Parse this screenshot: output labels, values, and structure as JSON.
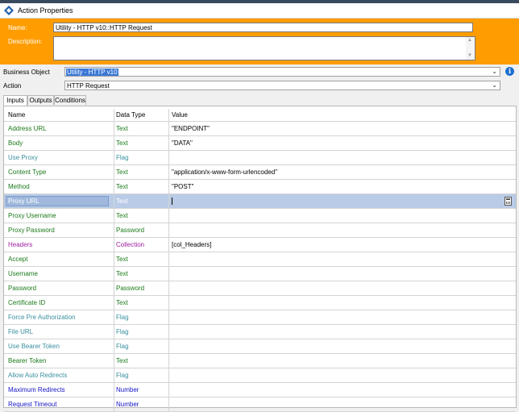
{
  "window": {
    "title": "Action Properties"
  },
  "header": {
    "name_label": "Name:",
    "name_value": "Utility - HTTP v10::HTTP Request",
    "description_label": "Description:",
    "description_value": ""
  },
  "business_object": {
    "label": "Business Object",
    "value": "Utility - HTTP v10"
  },
  "action": {
    "label": "Action",
    "value": "HTTP Request"
  },
  "tabs": [
    {
      "label": "Inputs",
      "active": true
    },
    {
      "label": "Outputs",
      "active": false
    },
    {
      "label": "Conditions",
      "active": false
    }
  ],
  "grid": {
    "columns": [
      "Name",
      "Data Type",
      "Value"
    ],
    "rows": [
      {
        "name": "Address URL",
        "type": "Text",
        "value": "\"ENDPOINT\""
      },
      {
        "name": "Body",
        "type": "Text",
        "value": "\"DATA\""
      },
      {
        "name": "Use Proxy",
        "type": "Flag",
        "value": ""
      },
      {
        "name": "Content Type",
        "type": "Text",
        "value": "\"application/x-www-form-urlencoded\""
      },
      {
        "name": "Method",
        "type": "Text",
        "value": "\"POST\""
      },
      {
        "name": "Proxy URL",
        "type": "Text",
        "value": ""
      },
      {
        "name": "Proxy Username",
        "type": "Text",
        "value": ""
      },
      {
        "name": "Proxy Password",
        "type": "Password",
        "value": ""
      },
      {
        "name": "Headers",
        "type": "Collection",
        "value": "[col_Headers]"
      },
      {
        "name": "Accept",
        "type": "Text",
        "value": ""
      },
      {
        "name": "Username",
        "type": "Text",
        "value": ""
      },
      {
        "name": "Password",
        "type": "Password",
        "value": ""
      },
      {
        "name": "Certificate ID",
        "type": "Text",
        "value": ""
      },
      {
        "name": "Force Pre Authorization",
        "type": "Flag",
        "value": ""
      },
      {
        "name": "File URL",
        "type": "Flag",
        "value": ""
      },
      {
        "name": "Use Bearer Token",
        "type": "Flag",
        "value": ""
      },
      {
        "name": "Bearer Token",
        "type": "Text",
        "value": ""
      },
      {
        "name": "Allow Auto Redirects",
        "type": "Flag",
        "value": ""
      },
      {
        "name": "Maximum Redirects",
        "type": "Number",
        "value": ""
      },
      {
        "name": "Request Timeout",
        "type": "Number",
        "value": ""
      }
    ],
    "selected_row": 5
  },
  "colors": {
    "header_bg": "#ff9c00",
    "text_type": "#1a7a1a",
    "flag_type": "#3a8fa0",
    "collection_type": "#a020a0",
    "number_type": "#1515c8",
    "selection": "#b9cbe6"
  },
  "icons": {
    "app": "blue-prism-icon",
    "info": "info-icon",
    "dropdown": "chevron-down-icon",
    "value_editor": "calculator-icon"
  }
}
